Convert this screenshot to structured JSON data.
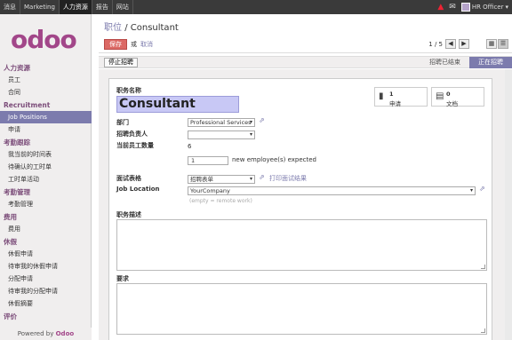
{
  "topbar": {
    "menu": [
      "消息",
      "Marketing",
      "人力资源",
      "报告",
      "网站"
    ],
    "active_menu_index": 2,
    "user_name": "HR Officer"
  },
  "sidebar": {
    "logo": "odoo",
    "sections": [
      {
        "title": "人力资源",
        "items": [
          "员工",
          "合同"
        ]
      },
      {
        "title": "Recruitment",
        "items": [
          "Job Positions",
          "申请"
        ]
      },
      {
        "title": "考勤跟踪",
        "items": [
          "我当前的时间表",
          "待确认的工时单",
          "工时单活动"
        ]
      },
      {
        "title": "考勤管理",
        "items": [
          "考勤管理"
        ]
      },
      {
        "title": "费用",
        "items": [
          "费用"
        ]
      },
      {
        "title": "休假",
        "items": [
          "休假申请",
          "待审我的休假申请",
          "分配申请",
          "待审我的分配申请",
          "休假摘要"
        ]
      },
      {
        "title": "评价",
        "items": []
      }
    ],
    "active_item": "Job Positions",
    "powered_prefix": "Powered by",
    "powered_brand": "Odoo"
  },
  "header": {
    "breadcrumb_parent": "职位",
    "breadcrumb_sep": "/",
    "breadcrumb_current": "Consultant",
    "save_label": "保存",
    "or_label": "或",
    "discard_label": "取消",
    "pager_text": "1 / 5"
  },
  "status": {
    "stop_button": "停止招聘",
    "stage_done": "招聘已结束",
    "stage_current": "正在招聘"
  },
  "form": {
    "name_label": "职务名称",
    "name_value": "Consultant",
    "stat_applications_count": "1",
    "stat_applications_label": "申请",
    "stat_documents_count": "0",
    "stat_documents_label": "文档",
    "department_label": "部门",
    "department_value": "Professional Services",
    "recruiter_label": "招聘负责人",
    "recruiter_value": "",
    "current_employees_label": "当前员工数量",
    "current_employees_value": "6",
    "expected_value": "1",
    "expected_suffix": "new employee(s) expected",
    "interview_form_label": "面试表格",
    "interview_form_value": "招聘表单",
    "print_interview_link": "打印面试结果",
    "job_location_label": "Job Location",
    "job_location_value": "YourCompany",
    "job_location_hint": "(empty = remote work)",
    "description_label": "职务描述",
    "requirements_label": "要求"
  },
  "colors": {
    "accent": "#7c7bad",
    "brand": "#a24689",
    "save": "#dc6965",
    "topbar": "#3a3a3a"
  }
}
